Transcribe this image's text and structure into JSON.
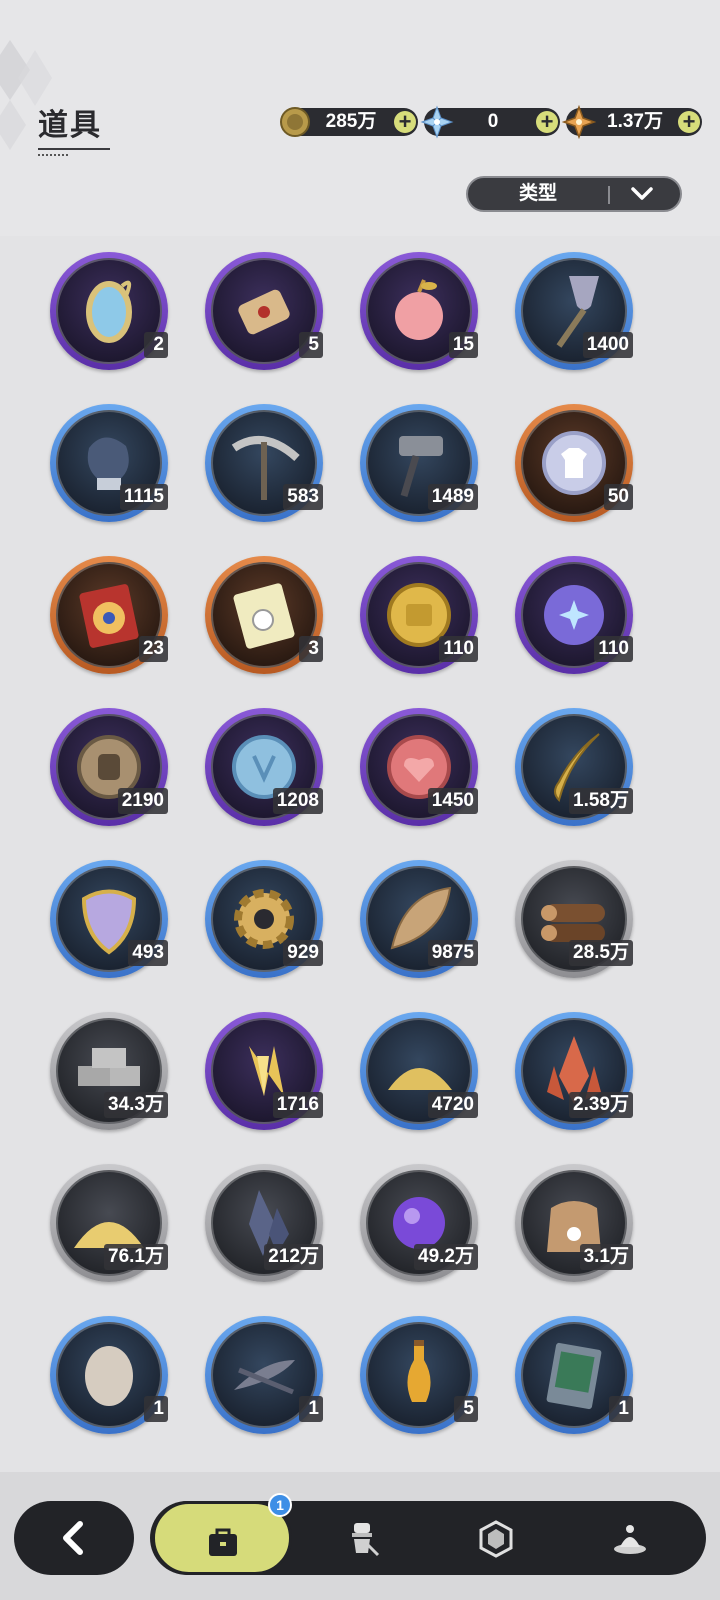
{
  "header": {
    "title": "道具"
  },
  "currencies": [
    {
      "icon": "gold-coin-icon",
      "value": "285万"
    },
    {
      "icon": "crystal-flower-icon",
      "value": "0"
    },
    {
      "icon": "star-crystal-icon",
      "value": "1.37万"
    }
  ],
  "filter": {
    "label": "类型"
  },
  "items": [
    {
      "icon": "mirror-icon",
      "tier": "purple",
      "count": "2"
    },
    {
      "icon": "scroll-icon",
      "tier": "purple",
      "count": "5"
    },
    {
      "icon": "apple-icon",
      "tier": "purple",
      "count": "15"
    },
    {
      "icon": "shovel-icon",
      "tier": "blue",
      "count": "1400"
    },
    {
      "icon": "boxing-glove-icon",
      "tier": "blue",
      "count": "1115"
    },
    {
      "icon": "pickaxe-icon",
      "tier": "blue",
      "count": "583"
    },
    {
      "icon": "hammer-icon",
      "tier": "blue",
      "count": "1489"
    },
    {
      "icon": "shirt-coin-icon",
      "tier": "orange",
      "count": "50"
    },
    {
      "icon": "wheel-ticket-icon",
      "tier": "orange",
      "count": "23"
    },
    {
      "icon": "rainbow-ticket-icon",
      "tier": "orange",
      "count": "3"
    },
    {
      "icon": "gold-suitcase-coin-icon",
      "tier": "purple",
      "count": "110"
    },
    {
      "icon": "star-orb-icon",
      "tier": "purple",
      "count": "110"
    },
    {
      "icon": "fist-coin-icon",
      "tier": "purple",
      "count": "2190"
    },
    {
      "icon": "blue-crest-coin-icon",
      "tier": "purple",
      "count": "1208"
    },
    {
      "icon": "heart-coin-icon",
      "tier": "purple",
      "count": "1450"
    },
    {
      "icon": "golden-fang-icon",
      "tier": "blue",
      "count": "1.58万"
    },
    {
      "icon": "scale-shield-icon",
      "tier": "blue",
      "count": "493"
    },
    {
      "icon": "gear-icon",
      "tier": "blue",
      "count": "929"
    },
    {
      "icon": "leaf-icon",
      "tier": "blue",
      "count": "9875"
    },
    {
      "icon": "wood-log-icon",
      "tier": "gray",
      "count": "28.5万"
    },
    {
      "icon": "stone-brick-icon",
      "tier": "gray",
      "count": "34.3万"
    },
    {
      "icon": "gold-crystal-icon",
      "tier": "purple",
      "count": "1716"
    },
    {
      "icon": "gold-dust-icon",
      "tier": "blue",
      "count": "4720"
    },
    {
      "icon": "red-crystal-icon",
      "tier": "blue",
      "count": "2.39万"
    },
    {
      "icon": "sand-pile-icon",
      "tier": "gray",
      "count": "76.1万"
    },
    {
      "icon": "dark-crystal-icon",
      "tier": "gray",
      "count": "212万"
    },
    {
      "icon": "purple-orb-icon",
      "tier": "gray",
      "count": "49.2万"
    },
    {
      "icon": "feed-sack-icon",
      "tier": "gray",
      "count": "3.1万"
    },
    {
      "icon": "egg-icon",
      "tier": "blue",
      "count": "1"
    },
    {
      "icon": "feather-bundle-icon",
      "tier": "blue",
      "count": "1"
    },
    {
      "icon": "potion-vial-icon",
      "tier": "blue",
      "count": "5"
    },
    {
      "icon": "forest-card-icon",
      "tier": "blue",
      "count": "1"
    }
  ],
  "bottom_nav": {
    "back": "back-arrow-icon",
    "tabs": [
      {
        "icon": "bag-icon",
        "active": true,
        "badge": "1"
      },
      {
        "icon": "chef-outfit-icon",
        "active": false
      },
      {
        "icon": "hexagon-gem-icon",
        "active": false
      },
      {
        "icon": "pudding-dish-icon",
        "active": false
      }
    ]
  },
  "colors": {
    "background": "#e6e6e8",
    "dark_bar": "#222327",
    "accent_yellow": "#d6db7a",
    "tier_purple": "#7a4ac8",
    "tier_blue": "#4a86db",
    "tier_orange": "#d2723a",
    "tier_gray": "#b0b0b4",
    "badge_blue": "#3d8ee6"
  }
}
